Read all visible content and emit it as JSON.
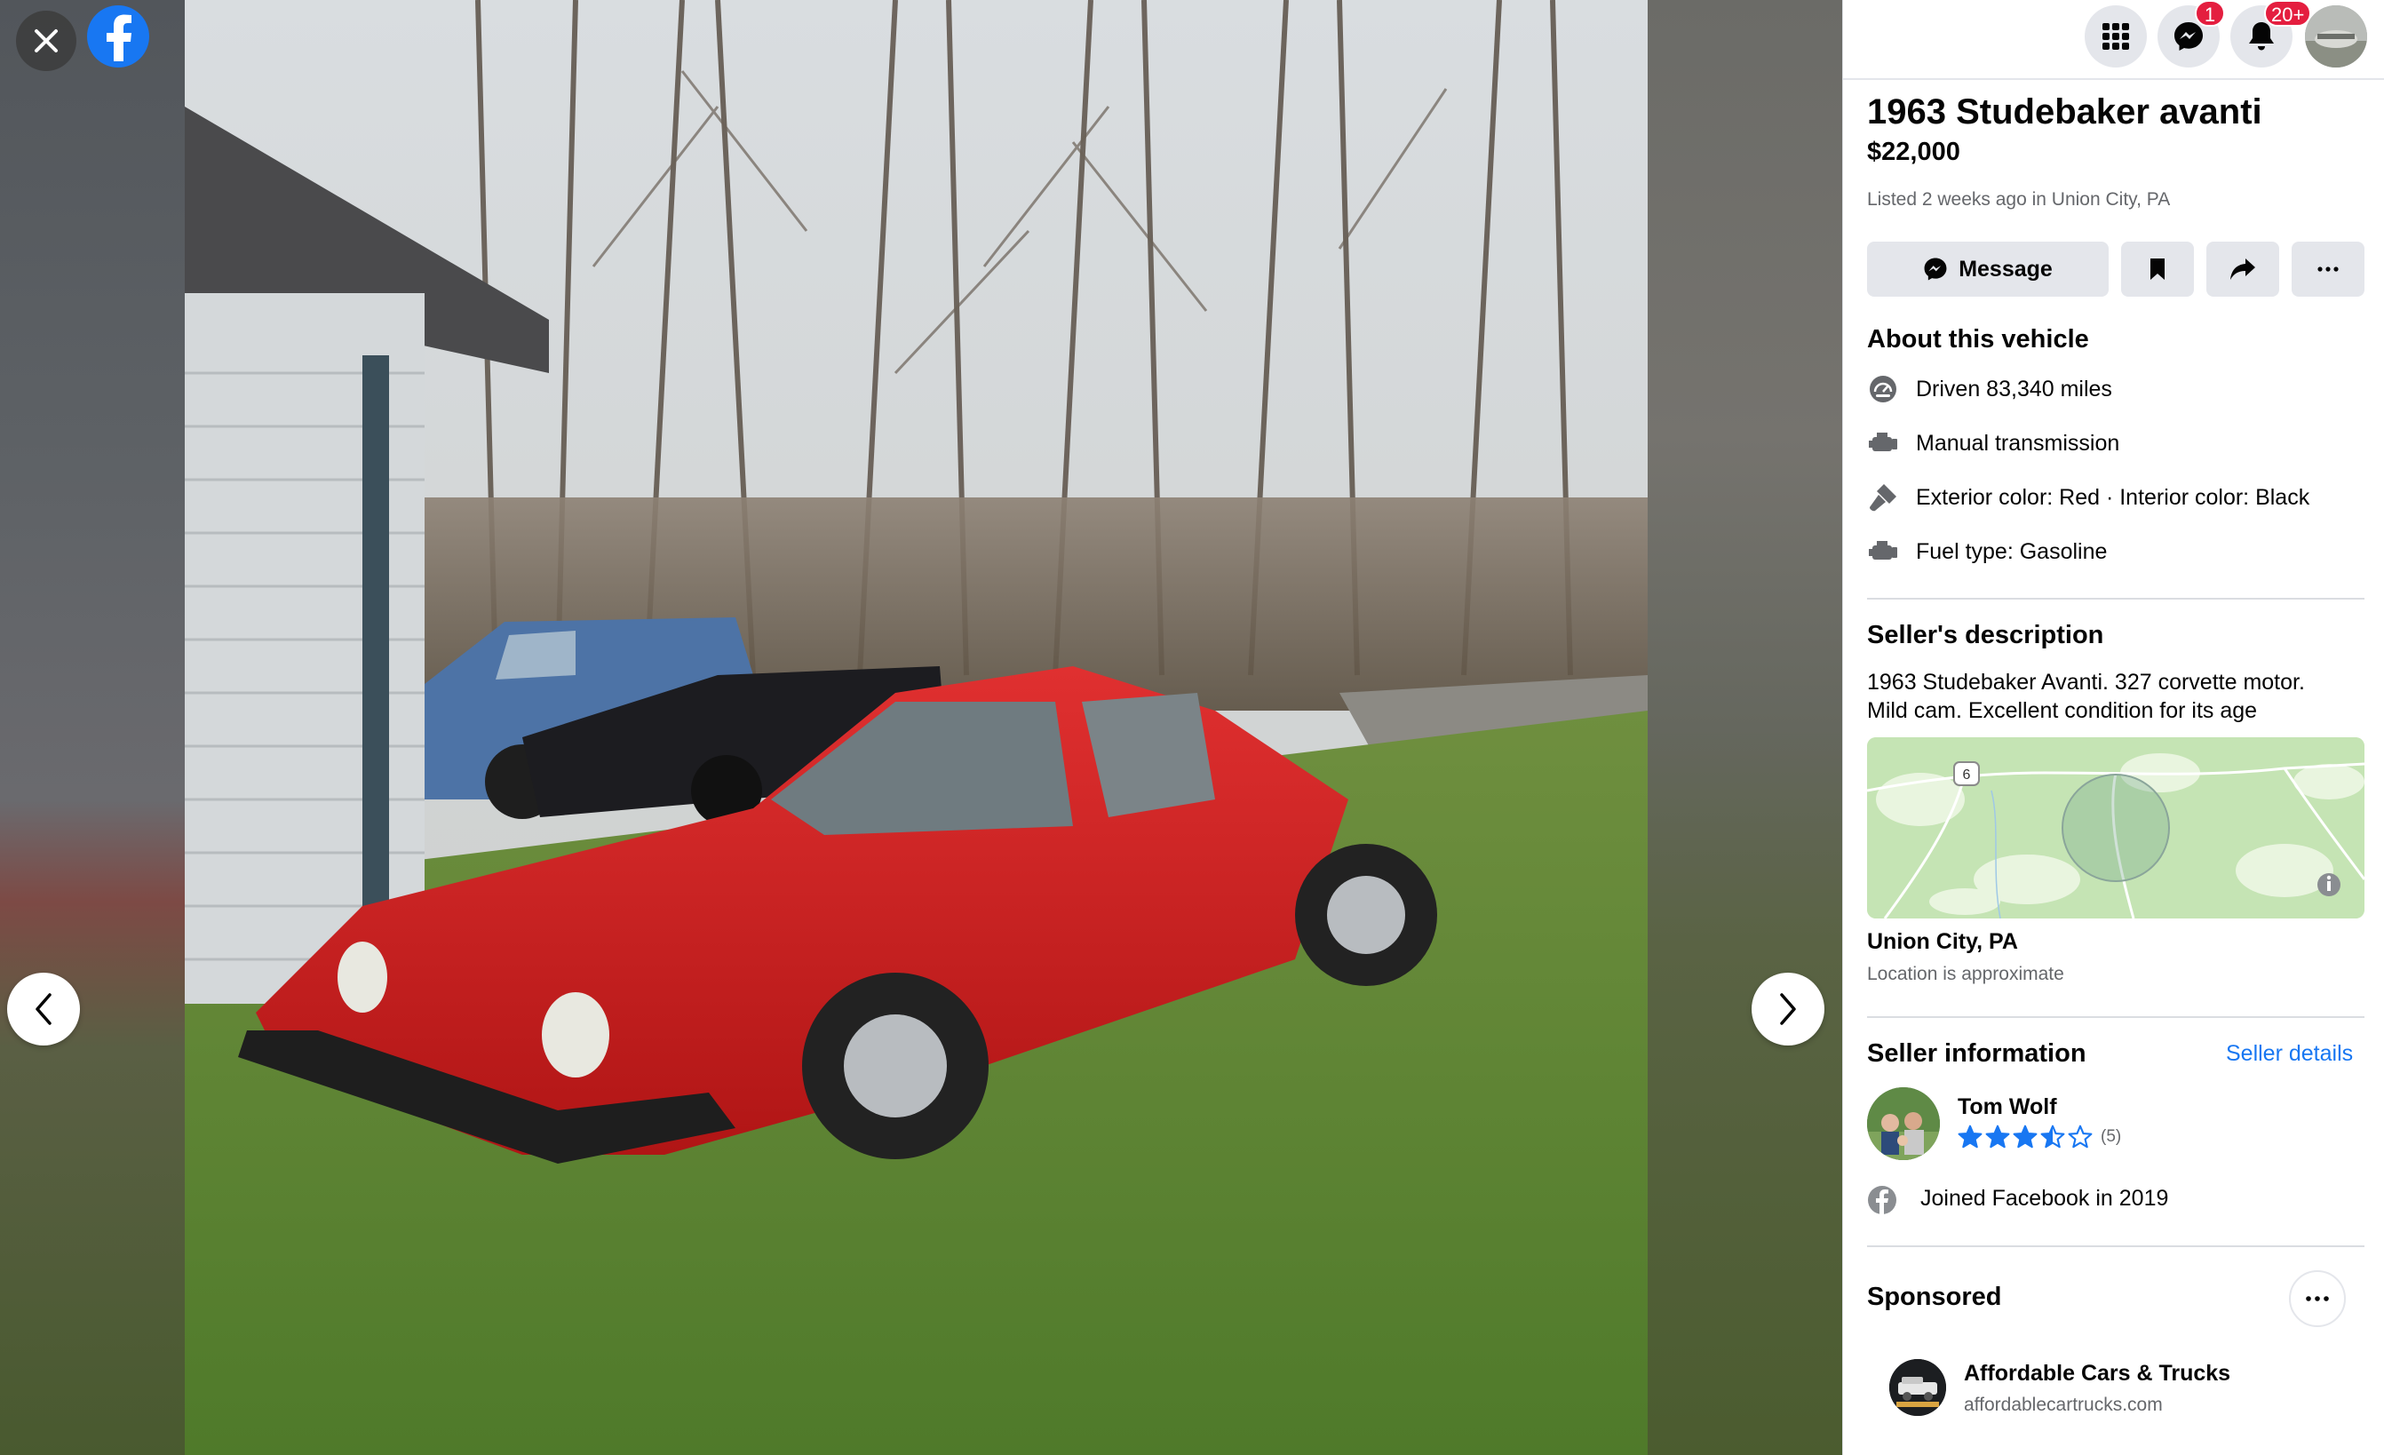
{
  "viewer": {
    "close_icon": "close-icon",
    "logo_icon": "facebook-logo",
    "prev_icon": "chevron-left-icon",
    "next_icon": "chevron-right-icon"
  },
  "topbar": {
    "menu_icon": "grid-menu-icon",
    "messenger_icon": "messenger-icon",
    "messenger_badge": "1",
    "notifications_icon": "bell-icon",
    "notifications_badge": "20+"
  },
  "listing": {
    "title": "1963 Studebaker avanti",
    "price": "$22,000",
    "listed": "Listed 2 weeks ago in Union City, PA"
  },
  "actions": {
    "message_label": "Message",
    "save_icon": "bookmark-icon",
    "share_icon": "share-icon",
    "more_icon": "more-icon"
  },
  "about": {
    "heading": "About this vehicle",
    "items": [
      {
        "icon": "speedometer-icon",
        "label": "Driven 83,340 miles"
      },
      {
        "icon": "transmission-icon",
        "label": "Manual transmission"
      },
      {
        "icon": "paint-icon",
        "label": "Exterior color: Red · Interior color: Black"
      },
      {
        "icon": "engine-icon",
        "label": "Fuel type: Gasoline"
      }
    ]
  },
  "description": {
    "heading": "Seller's description",
    "text": "1963 Studebaker Avanti.  327 corvette motor.\nMild cam. Excellent condition for its age"
  },
  "location": {
    "map_route_label": "6",
    "name": "Union City, PA",
    "note": "Location is approximate"
  },
  "seller": {
    "heading": "Seller information",
    "details_link": "Seller details",
    "name": "Tom Wolf",
    "rating": 3.5,
    "rating_max": 5,
    "rating_count": "(5)",
    "joined": "Joined Facebook in 2019"
  },
  "sponsored": {
    "heading": "Sponsored",
    "advertiser": "Affordable Cars & Trucks",
    "url": "affordablecartrucks.com"
  },
  "colors": {
    "accent": "#1877f2",
    "badge": "#e41e3f",
    "button_bg": "#e4e6eb",
    "secondary_text": "#65676b"
  }
}
